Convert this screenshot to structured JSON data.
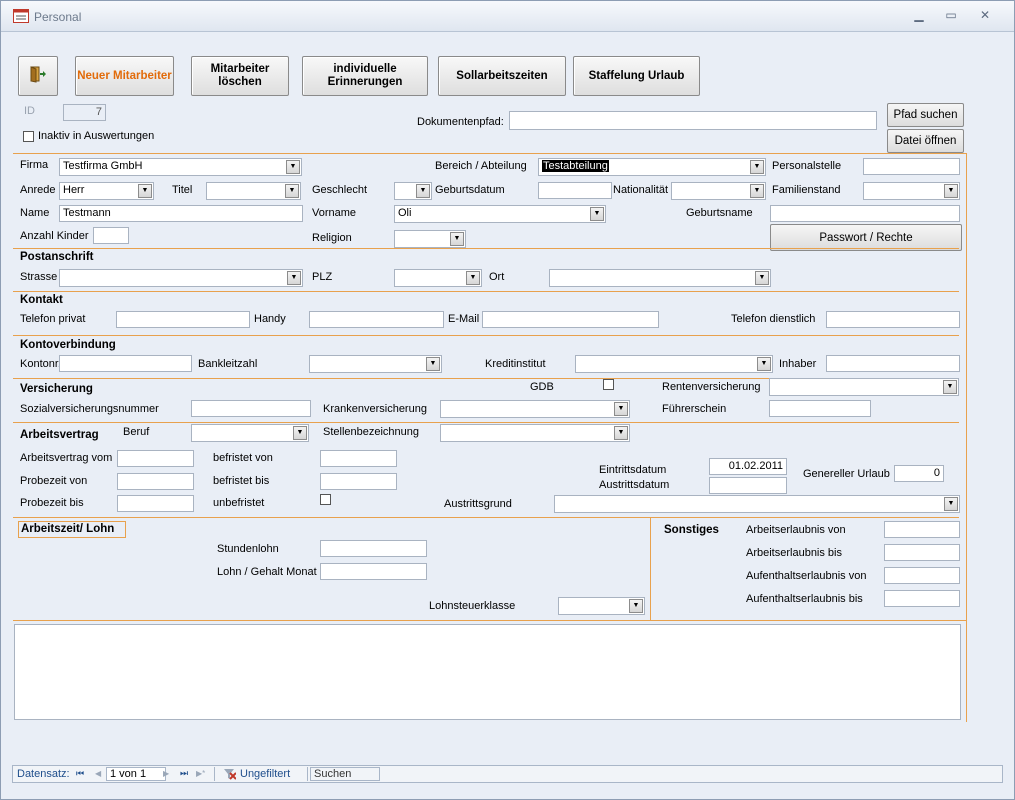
{
  "window": {
    "title": "Personal",
    "minimize": "▁",
    "restore": "▭",
    "close": "✕"
  },
  "toolbar": {
    "exit_icon": "exit-door-icon",
    "new_employee": "Neuer Mitarbeiter",
    "delete_employee": "Mitarbeiter löschen",
    "reminders": "individuelle Erinnerungen",
    "target_hours": "Sollarbeitszeiten",
    "vacation_scale": "Staffelung Urlaub"
  },
  "header": {
    "id_label": "ID",
    "id_value": "7",
    "inactive_label": "Inaktiv in Auswertungen",
    "doc_path_label": "Dokumentenpfad:",
    "doc_path_value": "",
    "search_path_button": "Pfad suchen",
    "open_file_button": "Datei öffnen"
  },
  "person": {
    "firma_label": "Firma",
    "firma_value": "Testfirma GmbH",
    "bereich_label": "Bereich / Abteilung",
    "bereich_value": "Testabteilung",
    "personalstelle_label": "Personalstelle",
    "personalstelle_value": "",
    "anrede_label": "Anrede",
    "anrede_value": "Herr",
    "titel_label": "Titel",
    "titel_value": "",
    "geschlecht_label": "Geschlecht",
    "geschlecht_value": "",
    "geburtsdatum_label": "Geburtsdatum",
    "geburtsdatum_value": "",
    "nationalitaet_label": "Nationalität",
    "nationalitaet_value": "",
    "familienstand_label": "Familienstand",
    "familienstand_value": "",
    "name_label": "Name",
    "name_value": "Testmann",
    "vorname_label": "Vorname",
    "vorname_value": "Oli",
    "geburtsname_label": "Geburtsname",
    "geburtsname_value": "",
    "kinder_label": "Anzahl Kinder",
    "kinder_value": "",
    "religion_label": "Religion",
    "religion_value": "",
    "password_button": "Passwort / Rechte"
  },
  "postanschrift": {
    "title": "Postanschrift",
    "strasse_label": "Strasse",
    "plz_label": "PLZ",
    "ort_label": "Ort"
  },
  "kontakt": {
    "title": "Kontakt",
    "tel_privat_label": "Telefon privat",
    "handy_label": "Handy",
    "email_label": "E-Mail",
    "tel_dienst_label": "Telefon dienstlich"
  },
  "konto": {
    "title": "Kontoverbindung",
    "kontonr_label": "Kontonr.",
    "blz_label": "Bankleitzahl",
    "kreditinstitut_label": "Kreditinstitut",
    "inhaber_label": "Inhaber"
  },
  "versicherung": {
    "title": "Versicherung",
    "gdb_label": "GDB",
    "renten_label": "Rentenversicherung",
    "sozial_label": "Sozialversicherungsnummer",
    "kranken_label": "Krankenversicherung",
    "fuehrerschein_label": "Führerschein"
  },
  "vertrag": {
    "title": "Arbeitsvertrag",
    "beruf_label": "Beruf",
    "stelle_label": "Stellenbezeichnung",
    "vom_label": "Arbeitsvertrag vom",
    "befristet_von_label": "befristet von",
    "probe_von_label": "Probezeit von",
    "befristet_bis_label": "befristet bis",
    "probe_bis_label": "Probezeit bis",
    "unbefristet_label": "unbefristet",
    "eintritt_label": "Eintrittsdatum",
    "eintritt_value": "01.02.2011",
    "austritt_label": "Austrittsdatum",
    "urlaub_label": "Genereller Urlaub",
    "urlaub_value": "0",
    "austrittsgrund_label": "Austrittsgrund"
  },
  "lohn": {
    "title": "Arbeitszeit/ Lohn",
    "stundenlohn_label": "Stundenlohn",
    "monat_label": "Lohn / Gehalt Monat",
    "steuerklasse_label": "Lohnsteuerklasse"
  },
  "sonstiges": {
    "title": "Sonstiges",
    "ae_von_label": "Arbeitserlaubnis von",
    "ae_bis_label": "Arbeitserlaubnis bis",
    "aufe_von_label": "Aufenthaltserlaubnis von",
    "aufe_bis_label": "Aufenthaltserlaubnis bis"
  },
  "navigation": {
    "record_label": "Datensatz:",
    "first": "⏮",
    "prev": "◀",
    "record_value": "1 von 1",
    "next": "▶",
    "last": "⏭",
    "new": "▶*",
    "filter_label": "Ungefiltert",
    "search_placeholder": "Suchen"
  }
}
